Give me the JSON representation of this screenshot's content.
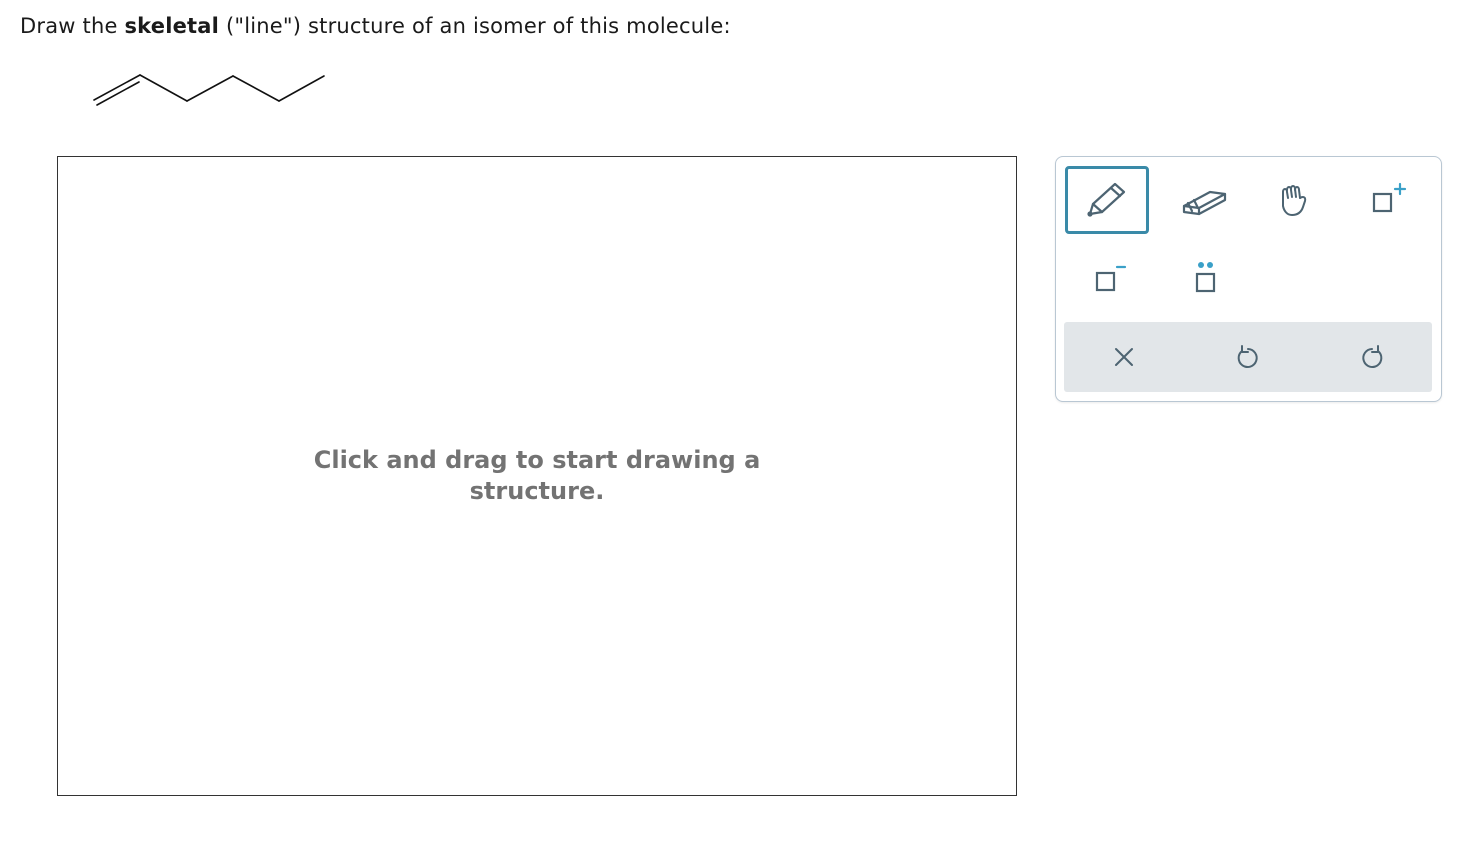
{
  "question": {
    "prefix": "Draw the ",
    "bold": "skeletal",
    "suffix": " (\"line\") structure of an isomer of this molecule:"
  },
  "molecule": {
    "name": "molecule-skeletal-structure"
  },
  "canvas": {
    "hint_line1": "Click and drag to start drawing a",
    "hint_line2": "structure."
  },
  "toolbar": {
    "tools": [
      {
        "name": "pencil-tool",
        "icon": "pencil-icon",
        "selected": true
      },
      {
        "name": "eraser-tool",
        "icon": "eraser-icon",
        "selected": false
      },
      {
        "name": "hand-tool",
        "icon": "hand-icon",
        "selected": false
      },
      {
        "name": "positive-charge-tool",
        "icon": "plus-charge-icon",
        "selected": false
      },
      {
        "name": "negative-charge-tool",
        "icon": "minus-charge-icon",
        "selected": false
      },
      {
        "name": "lone-pair-tool",
        "icon": "lone-pair-icon",
        "selected": false
      }
    ],
    "actions": [
      {
        "name": "clear-button",
        "icon": "close-icon"
      },
      {
        "name": "undo-button",
        "icon": "undo-icon"
      },
      {
        "name": "redo-button",
        "icon": "redo-icon"
      }
    ]
  },
  "colors": {
    "accent": "#3a8aa8",
    "icon": "#4d6472",
    "charge": "#3aa0c8",
    "actionbar_bg": "#e2e6e9",
    "hint_text": "#737373"
  }
}
